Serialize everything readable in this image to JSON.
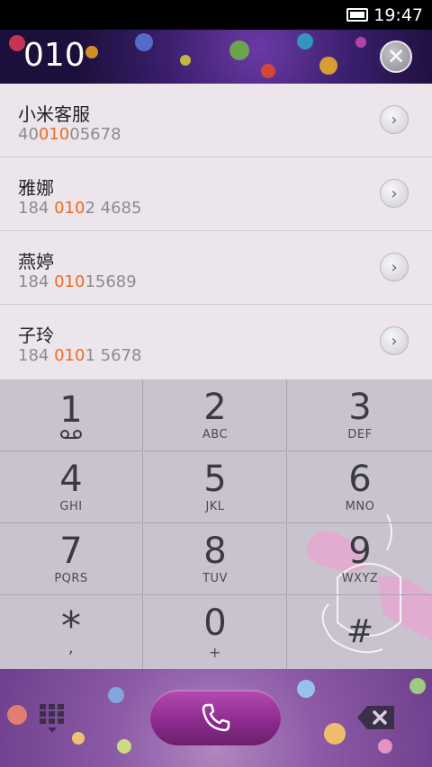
{
  "status_bar": {
    "time": "19:47"
  },
  "header": {
    "dialed_number": "010"
  },
  "contacts": [
    {
      "name": "小米客服",
      "number_pre": "40",
      "number_match": "010",
      "number_post": "05678"
    },
    {
      "name": "雅娜",
      "number_pre": "184 ",
      "number_match": "010",
      "number_post": "2 4685"
    },
    {
      "name": "燕婷",
      "number_pre": "184 ",
      "number_match": "010",
      "number_post": "15689"
    },
    {
      "name": "子玲",
      "number_pre": "184 ",
      "number_match": "010",
      "number_post": "1 5678"
    }
  ],
  "keypad": [
    {
      "digit": "1",
      "letters": ""
    },
    {
      "digit": "2",
      "letters": "ABC"
    },
    {
      "digit": "3",
      "letters": "DEF"
    },
    {
      "digit": "4",
      "letters": "GHI"
    },
    {
      "digit": "5",
      "letters": "JKL"
    },
    {
      "digit": "6",
      "letters": "MNO"
    },
    {
      "digit": "7",
      "letters": "PQRS"
    },
    {
      "digit": "8",
      "letters": "TUV"
    },
    {
      "digit": "9",
      "letters": "WXYZ"
    },
    {
      "digit": "*",
      "letters": ","
    },
    {
      "digit": "0",
      "letters": "+"
    },
    {
      "digit": "#",
      "letters": ""
    }
  ],
  "icons": {
    "clear": "close-icon",
    "contact_arrow": "chevron-right-icon",
    "voicemail": "voicemail-icon",
    "dialpad_toggle": "dialpad-icon",
    "call": "phone-icon",
    "delete": "backspace-icon"
  },
  "colors": {
    "match_highlight": "#ee6a1e",
    "call_button": "#9b3597",
    "header_bg": "#2a164f"
  }
}
